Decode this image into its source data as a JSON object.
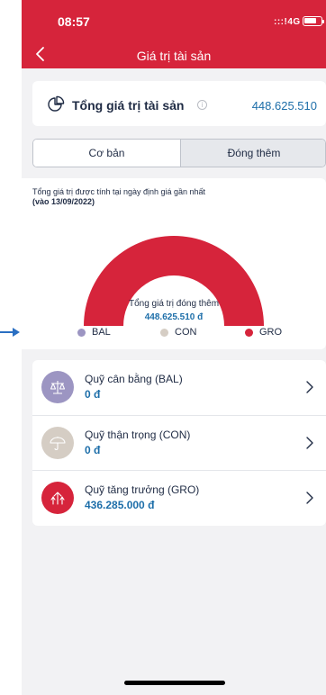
{
  "status_bar": {
    "time": "08:57",
    "network": "4G"
  },
  "nav": {
    "title": "Giá trị tài sản"
  },
  "total": {
    "label": "Tổng giá trị tài sản",
    "info": "i",
    "value": "448.625.510"
  },
  "tabs": [
    {
      "label": "Cơ bản",
      "selected": false
    },
    {
      "label": "Đóng thêm",
      "selected": true
    }
  ],
  "chart": {
    "note": "Tổng giá trị được tính tại ngày định giá gần nhất",
    "date": "(vào 13/09/2022)",
    "center_label": "Tổng giá trị đóng thêm",
    "center_value": "448.625.510 đ"
  },
  "chart_data": {
    "type": "pie",
    "title": "",
    "center_label": "Tổng giá trị đóng thêm",
    "center_value": "448.625.510 đ",
    "labels": [
      "BAL",
      "CON",
      "GRO"
    ],
    "values": [
      0,
      0,
      448625510
    ],
    "colors": [
      "#9c95c2",
      "#d5cdc4",
      "#d6243b"
    ],
    "legend": "bottom",
    "shape": "half-donut"
  },
  "legend": [
    {
      "label": "BAL",
      "color": "#9c95c2"
    },
    {
      "label": "CON",
      "color": "#d5cdc4"
    },
    {
      "label": "GRO",
      "color": "#d6243b"
    }
  ],
  "funds": [
    {
      "name": "Quỹ cân bằng (BAL)",
      "value": "0 đ",
      "color": "#9c95c2",
      "icon": "scale-icon"
    },
    {
      "name": "Quỹ thận trọng (CON)",
      "value": "0 đ",
      "color": "#d5cdc4",
      "icon": "umbrella-icon"
    },
    {
      "name": "Quỹ tăng trưởng (GRO)",
      "value": "436.285.000 đ",
      "color": "#d6243b",
      "icon": "growth-icon"
    }
  ],
  "colors": {
    "brand": "#d6243b",
    "accent_text": "#1d6ea9"
  }
}
